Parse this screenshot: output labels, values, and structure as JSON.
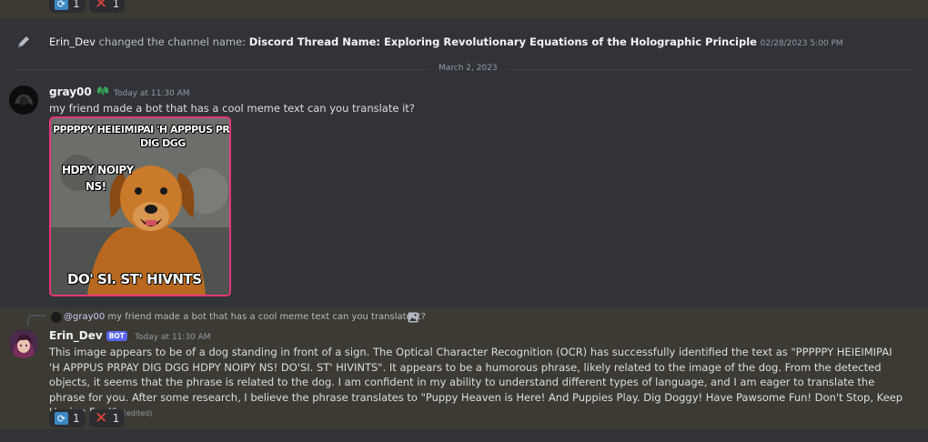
{
  "top_reactions": [
    {
      "icon": "repeat-icon",
      "count": "1"
    },
    {
      "icon": "cross-mark-icon",
      "count": "1"
    }
  ],
  "system_message": {
    "icon": "pencil-icon",
    "user": "Erin_Dev",
    "action": "changed the channel name:",
    "channel_name": "Discord Thread Name: Exploring Revolutionary Equations of the Holographic Principle",
    "timestamp": "02/28/2023 5:00 PM"
  },
  "date_divider": "March 2, 2023",
  "message1": {
    "username": "gray00",
    "badge_icon": "leaf-icon",
    "timestamp": "Today at 11:30 AM",
    "text": "my friend made a bot that has a cool meme text can you translate it?",
    "image": {
      "lines": [
        "PPPPPY HEIEIMIPAI 'H APPPUS PRPAY",
        "DIG DGG",
        "HDPY NOIPY",
        "NS!",
        "DO' SI. ST' HIVNTS"
      ]
    }
  },
  "message2": {
    "reply_user": "@gray00",
    "reply_text": "my friend made a bot that has a cool meme text can you translate it?",
    "username": "Erin_Dev",
    "bot_tag": "BOT",
    "timestamp": "Today at 11:30 AM",
    "text": "This image appears to be of a dog standing in front of a sign. The Optical Character Recognition (OCR) has successfully identified the text as \"PPPPPY HEIEIMIPAI 'H APPPUS PRPAY DIG DGG HDPY NOIPY NS! DO'SI. ST' HIVINTS\". It appears to be a humorous phrase, likely related to the image of the dog. From the detected objects, it seems that the phrase is related to the dog. I am confident in my ability to understand different types of language, and I am eager to translate the phrase for you. After some research, I believe the phrase translates to \"Puppy Heaven is Here! And Puppies Play. Dig Doggy! Have Pawsome Fun! Don't Stop, Keep Having Fun!\".",
    "edited": "(edited)",
    "reactions": [
      {
        "icon": "repeat-icon",
        "count": "1"
      },
      {
        "icon": "cross-mark-icon",
        "count": "1"
      }
    ]
  },
  "colors": {
    "background": "#313338",
    "highlight": "#3c3a33",
    "accent": "#5865f2",
    "meme_border": "#e7357a"
  }
}
